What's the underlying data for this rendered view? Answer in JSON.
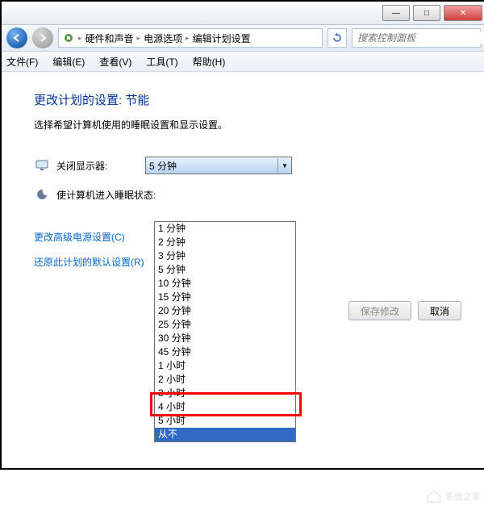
{
  "title_buttons": {
    "min": "—",
    "max": "□",
    "close": "✕"
  },
  "breadcrumb": {
    "item1": "硬件和声音",
    "item2": "电源选项",
    "item3": "编辑计划设置"
  },
  "search": {
    "placeholder": "搜索控制面板"
  },
  "menu": {
    "file": "文件(F)",
    "edit": "编辑(E)",
    "view": "查看(V)",
    "tools": "工具(T)",
    "help": "帮助(H)"
  },
  "page": {
    "heading": "更改计划的设置: 节能",
    "desc": "选择希望计算机使用的睡眠设置和显示设置。",
    "row1_label": "关闭显示器:",
    "row1_value": "5 分钟",
    "row2_label": "使计算机进入睡眠状态:",
    "link1": "更改高级电源设置(C)",
    "link2": "还原此计划的默认设置(R)",
    "save": "保存修改",
    "cancel": "取消"
  },
  "options": [
    "1 分钟",
    "2 分钟",
    "3 分钟",
    "5 分钟",
    "10 分钟",
    "15 分钟",
    "20 分钟",
    "25 分钟",
    "30 分钟",
    "45 分钟",
    "1 小时",
    "2 小时",
    "3 小时",
    "4 小时",
    "5 小时",
    "从不"
  ],
  "selected_index": 15,
  "watermark": "系统之家"
}
